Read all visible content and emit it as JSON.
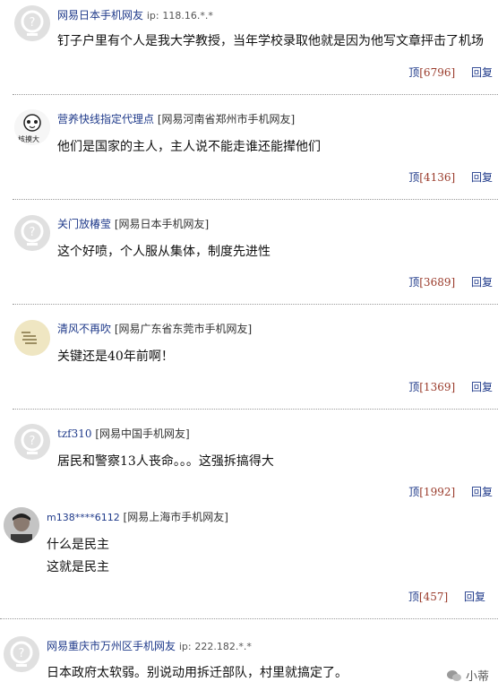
{
  "comments": [
    {
      "user": "网易日本手机网友",
      "ip_label": "ip:",
      "ip": "118.16.*.*",
      "text": "钉子户里有个人是我大学教授，当年学校录取他就是因为他写文章抨击了机场",
      "up_label": "顶",
      "count": "[6796]",
      "reply": "回复"
    },
    {
      "user": "营养快线指定代理点",
      "location": "[网易河南省郑州市手机网友]",
      "text": "他们是国家的主人，主人说不能走谁还能撵他们",
      "up_label": "顶",
      "count": "[4136]",
      "reply": "回复",
      "avatar_caption": "核摸大"
    },
    {
      "user": "关门放椿莹",
      "location": "[网易日本手机网友]",
      "text": "这个好喷，个人服从集体，制度先进性",
      "up_label": "顶",
      "count": "[3689]",
      "reply": "回复"
    },
    {
      "user": "清风不再吹",
      "location": "[网易广东省东莞市手机网友]",
      "text": "关键还是40年前啊！",
      "up_label": "顶",
      "count": "[1369]",
      "reply": "回复"
    },
    {
      "user": "tzf310",
      "location": "[网易中国手机网友]",
      "text": "居民和警察13人丧命。。。这强拆搞得大",
      "up_label": "顶",
      "count": "[1992]",
      "reply": "回复"
    },
    {
      "user": "m138****6112",
      "location": "[网易上海市手机网友]",
      "text_lines": [
        "什么是民主",
        "这就是民主"
      ],
      "up_label": "顶",
      "count": "[457]",
      "reply": "回复"
    },
    {
      "user": "网易重庆市万州区手机网友",
      "ip_label": "ip:",
      "ip": "222.182.*.*",
      "text": "日本政府太软弱。别说动用拆迁部队，村里就搞定了。"
    }
  ],
  "watermark": "小蒂",
  "colors": {
    "link": "#1f3a8a",
    "count": "#9a3b2b",
    "divider": "#9a9a9a"
  }
}
